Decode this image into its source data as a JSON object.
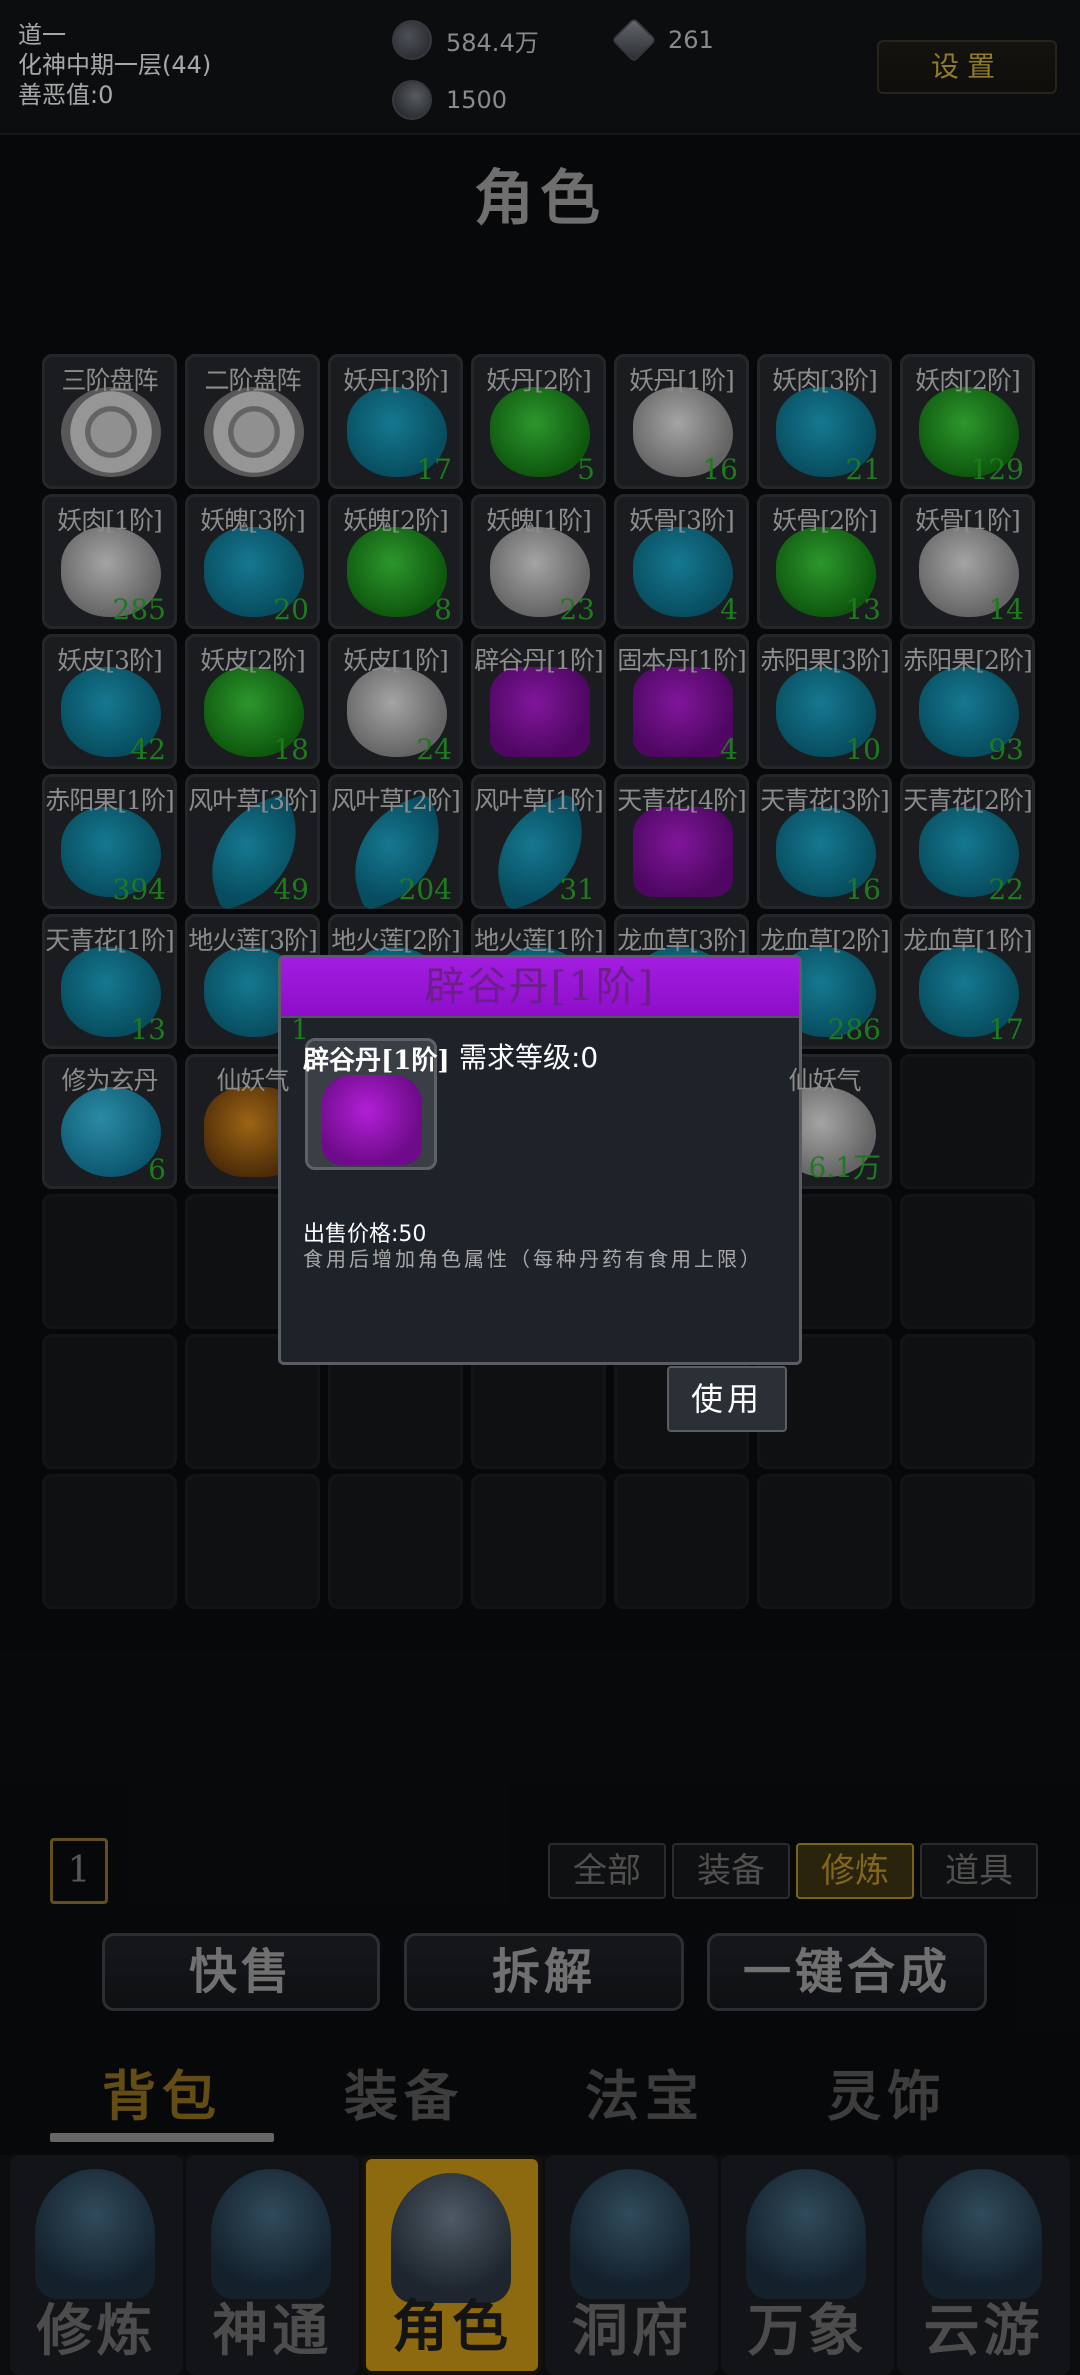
{
  "player": {
    "name": "道一",
    "realm": "化神中期一层(44)",
    "karma": "善恶值:0"
  },
  "resources": {
    "coin": "584.4万",
    "crystal": "261",
    "essence": "1500"
  },
  "settings_label": "设置",
  "page_title": "角色",
  "items": [
    {
      "name": "三阶盘阵",
      "count": "",
      "art": "taiji"
    },
    {
      "name": "二阶盘阵",
      "count": "",
      "art": "taiji"
    },
    {
      "name": "妖丹[3阶]",
      "count": "17",
      "art": "blue"
    },
    {
      "name": "妖丹[2阶]",
      "count": "5",
      "art": "green"
    },
    {
      "name": "妖丹[1阶]",
      "count": "16",
      "art": "white"
    },
    {
      "name": "妖肉[3阶]",
      "count": "21",
      "art": "blue"
    },
    {
      "name": "妖肉[2阶]",
      "count": "129",
      "art": "green"
    },
    {
      "name": "妖肉[1阶]",
      "count": "285",
      "art": "white"
    },
    {
      "name": "妖魄[3阶]",
      "count": "20",
      "art": "blue"
    },
    {
      "name": "妖魄[2阶]",
      "count": "8",
      "art": "green"
    },
    {
      "name": "妖魄[1阶]",
      "count": "23",
      "art": "white"
    },
    {
      "name": "妖骨[3阶]",
      "count": "4",
      "art": "blue"
    },
    {
      "name": "妖骨[2阶]",
      "count": "13",
      "art": "green"
    },
    {
      "name": "妖骨[1阶]",
      "count": "14",
      "art": "white"
    },
    {
      "name": "妖皮[3阶]",
      "count": "42",
      "art": "blue"
    },
    {
      "name": "妖皮[2阶]",
      "count": "18",
      "art": "green"
    },
    {
      "name": "妖皮[1阶]",
      "count": "24",
      "art": "white"
    },
    {
      "name": "辟谷丹[1阶]",
      "count": "",
      "art": "purple"
    },
    {
      "name": "固本丹[1阶]",
      "count": "4",
      "art": "purple"
    },
    {
      "name": "赤阳果[3阶]",
      "count": "10",
      "art": "blue"
    },
    {
      "name": "赤阳果[2阶]",
      "count": "93",
      "art": "blue"
    },
    {
      "name": "赤阳果[1阶]",
      "count": "394",
      "art": "blue"
    },
    {
      "name": "风叶草[3阶]",
      "count": "49",
      "art": "leaf"
    },
    {
      "name": "风叶草[2阶]",
      "count": "204",
      "art": "leaf"
    },
    {
      "name": "风叶草[1阶]",
      "count": "31",
      "art": "leaf"
    },
    {
      "name": "天青花[4阶]",
      "count": "",
      "art": "purple"
    },
    {
      "name": "天青花[3阶]",
      "count": "16",
      "art": "blue"
    },
    {
      "name": "天青花[2阶]",
      "count": "22",
      "art": "blue"
    },
    {
      "name": "天青花[1阶]",
      "count": "13",
      "art": "blue"
    },
    {
      "name": "地火莲[3阶]",
      "count": "1",
      "art": "blue"
    },
    {
      "name": "地火莲[2阶]",
      "count": "",
      "art": "blue"
    },
    {
      "name": "地火莲[1阶]",
      "count": "",
      "art": "blue"
    },
    {
      "name": "龙血草[3阶]",
      "count": "",
      "art": "blue"
    },
    {
      "name": "龙血草[2阶]",
      "count": "286",
      "art": "blue"
    },
    {
      "name": "龙血草[1阶]",
      "count": "17",
      "art": "blue"
    },
    {
      "name": "修为玄丹",
      "count": "6",
      "art": "orb"
    },
    {
      "name": "仙妖气",
      "count": "",
      "art": "orange"
    },
    {
      "name": "",
      "count": "",
      "art": "none"
    },
    {
      "name": "",
      "count": "",
      "art": "none"
    },
    {
      "name": "",
      "count": "",
      "art": "none"
    },
    {
      "name": "仙妖气",
      "count": "6.1万",
      "art": "white"
    },
    {
      "name": "",
      "count": "",
      "art": "empty"
    }
  ],
  "page_number": "1",
  "filters": [
    "全部",
    "装备",
    "修炼",
    "道具"
  ],
  "actions": {
    "quick_sell": "快售",
    "disassemble": "拆解",
    "one_click_craft": "一键合成"
  },
  "subtabs": [
    "背包",
    "装备",
    "法宝",
    "灵饰"
  ],
  "nav": [
    "修炼",
    "神通",
    "角色",
    "洞府",
    "万象",
    "云游"
  ],
  "popup": {
    "title": "辟谷丹[1阶]",
    "item_name": "辟谷丹[1阶]",
    "requirement": "需求等级:0",
    "price": "出售价格:50",
    "description": "食用后增加角色属性（每种丹药有食用上限）",
    "use_label": "使用"
  },
  "colors": {
    "accent_gold": "#c49215",
    "popup_header": "#9b17d9",
    "count_green": "#1f7a1f"
  }
}
